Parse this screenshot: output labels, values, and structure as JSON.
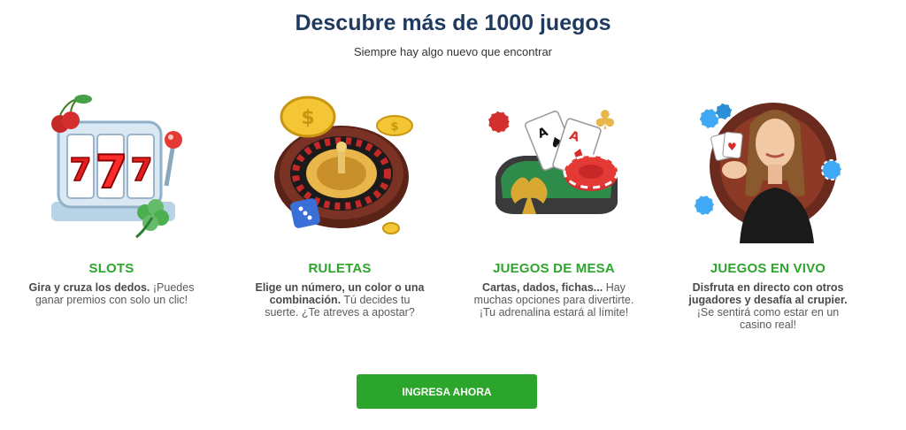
{
  "header": {
    "title": "Descubre más de 1000 juegos",
    "subtitle": "Siempre hay algo nuevo que encontrar"
  },
  "categories": [
    {
      "name": "SLOTS",
      "desc_bold": "Gira y cruza los dedos.",
      "desc_rest": "¡Puedes ganar premios con solo un clic!",
      "icon": "slot-machine-icon"
    },
    {
      "name": "RULETAS",
      "desc_bold": "Elige un número, un color o una combinación.",
      "desc_rest": "Tú decides tu suerte. ¿Te atreves a apostar?",
      "icon": "roulette-icon"
    },
    {
      "name": "JUEGOS DE MESA",
      "desc_bold": "Cartas, dados, fichas...",
      "desc_rest": "Hay muchas opciones para divertirte. ¡Tu adrenalina estará al límite!",
      "icon": "cards-table-icon"
    },
    {
      "name": "JUEGOS EN VIVO",
      "desc_bold": "Disfruta en directo con otros jugadores y desafía al crupier.",
      "desc_rest": "¡Se sentirá como estar en un casino real!",
      "icon": "live-dealer-icon"
    }
  ],
  "cta": {
    "label": "INGRESA AHORA"
  },
  "colors": {
    "title": "#1f3a5f",
    "accent": "#2ca52c",
    "text": "#5a5a5a"
  }
}
